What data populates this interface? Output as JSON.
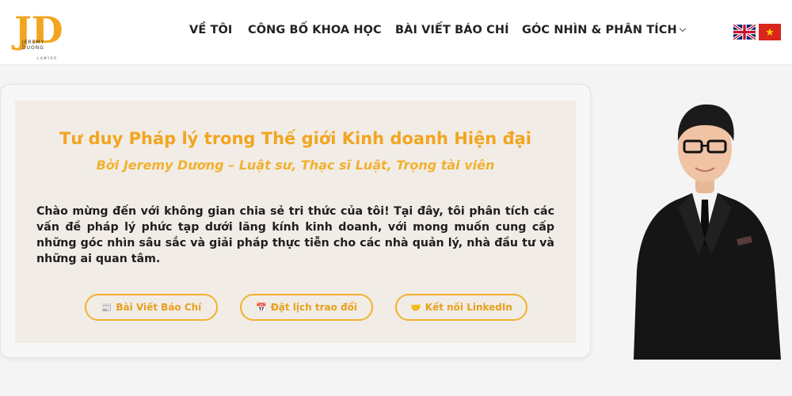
{
  "header": {
    "logo": {
      "monogram": "JD",
      "name": "JEREMY DUONG",
      "tagline": "LAWYER"
    },
    "nav": [
      {
        "label": "VỀ TÔI"
      },
      {
        "label": "CÔNG BỐ KHOA HỌC"
      },
      {
        "label": "BÀI VIẾT BÁO CHÍ"
      },
      {
        "label": "GÓC NHÌN & PHÂN TÍCH",
        "has_dropdown": true
      }
    ],
    "languages": [
      {
        "code": "en",
        "icon": "uk-flag-icon"
      },
      {
        "code": "vi",
        "icon": "vietnam-flag-icon"
      }
    ]
  },
  "hero": {
    "title": "Tư duy Pháp lý trong Thế giới Kinh doanh Hiện đại",
    "subtitle": "Bởi Jeremy Dương – Luật sư, Thạc sĩ Luật, Trọng tài viên",
    "intro": "Chào mừng đến với không gian chia sẻ tri thức của tôi! Tại đây, tôi phân tích các vấn đề pháp lý phức tạp dưới lăng kính kinh doanh, với mong muốn cung cấp những góc nhìn sâu sắc và giải pháp thực tiễn cho các nhà quản lý, nhà đầu tư và những ai quan tâm.",
    "buttons": [
      {
        "icon": "📰",
        "label": "Bài Viết Báo Chí"
      },
      {
        "icon": "📅",
        "label": "Đặt lịch trao đổi"
      },
      {
        "icon": "🤝",
        "label": "Kết nối LinkedIn"
      }
    ]
  },
  "colors": {
    "accent": "#f2a51f",
    "card_bg": "#f1ece6",
    "page_bg": "#f4f4f4",
    "text": "#1e1e1e"
  }
}
